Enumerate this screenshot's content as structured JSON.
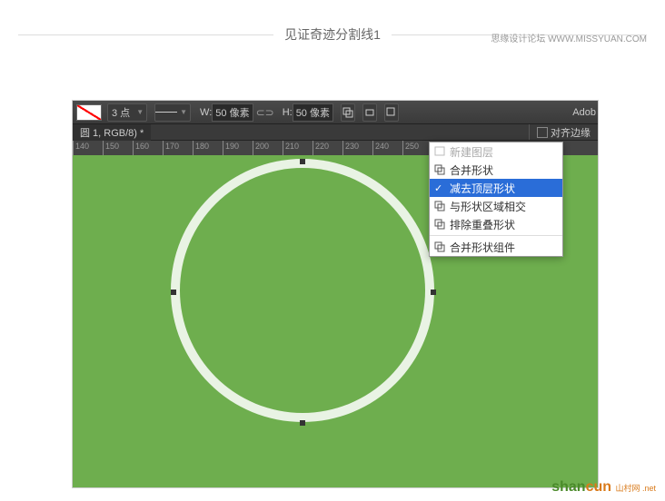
{
  "credit": "思缘设计论坛   WWW.MISSYUAN.COM",
  "divider": "见证奇迹分割线1",
  "toolbar": {
    "stroke_width": "3 点",
    "w_label": "W:",
    "w_value": "50 像素",
    "h_label": "H:",
    "h_value": "50 像素",
    "brand": "Adob",
    "align_edges": "对齐边缘"
  },
  "document_tab": "圆 1, RGB/8) *",
  "ruler_ticks": [
    "140",
    "150",
    "160",
    "170",
    "180",
    "190",
    "200",
    "210",
    "220",
    "230",
    "240",
    "250"
  ],
  "context_menu": {
    "items": [
      {
        "label": "新建图层",
        "disabled": true
      },
      {
        "label": "合并形状",
        "disabled": false
      },
      {
        "label": "减去顶层形状",
        "selected": true
      },
      {
        "label": "与形状区域相交",
        "disabled": false
      },
      {
        "label": "排除重叠形状",
        "disabled": false
      }
    ],
    "merge_components": "合并形状组件"
  },
  "watermark": {
    "p1": "shan",
    "p2": "cun",
    "sub": "山村网 .net"
  }
}
